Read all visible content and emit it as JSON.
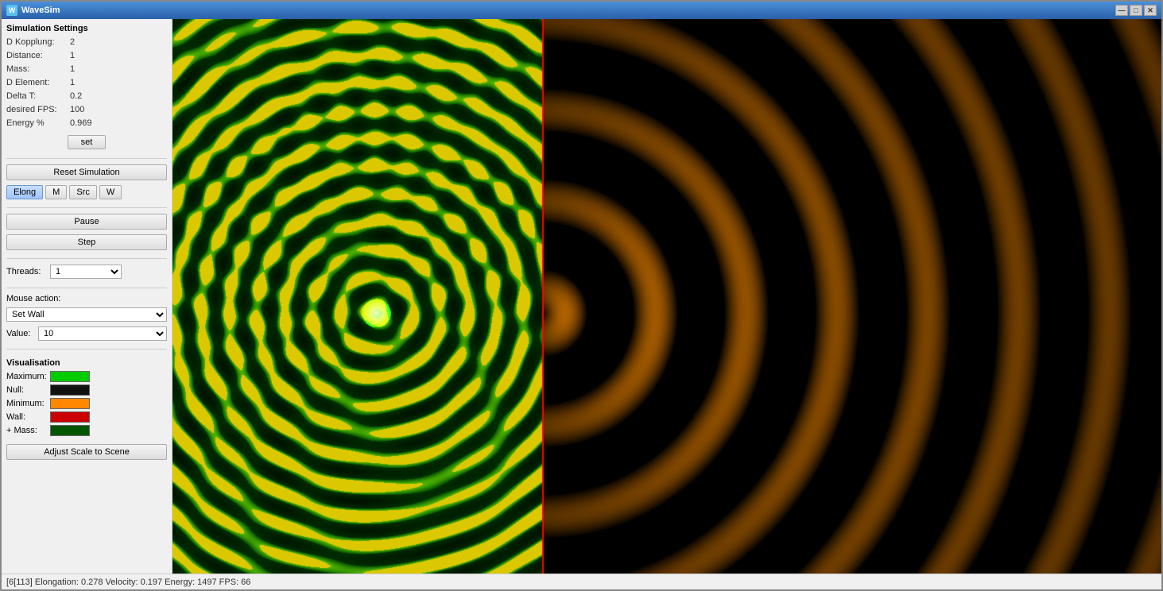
{
  "window": {
    "title": "WaveSim",
    "icon": "W"
  },
  "titlebar": {
    "minimize": "—",
    "maximize": "□",
    "close": "✕"
  },
  "sidebar": {
    "settings_title": "Simulation Settings",
    "fields": [
      {
        "label": "D Kopplung:",
        "value": "2"
      },
      {
        "label": "Distance:",
        "value": "1"
      },
      {
        "label": "Mass:",
        "value": "1"
      },
      {
        "label": "D Element:",
        "value": "1"
      },
      {
        "label": "Delta T:",
        "value": "0.2"
      },
      {
        "label": "desired FPS:",
        "value": "100"
      },
      {
        "label": "Energy %",
        "value": "0.969"
      }
    ],
    "set_button": "set",
    "reset_button": "Reset Simulation",
    "mode_buttons": [
      {
        "label": "Elong",
        "active": true
      },
      {
        "label": "M",
        "active": false
      },
      {
        "label": "Src",
        "active": false
      },
      {
        "label": "W",
        "active": false
      }
    ],
    "pause_button": "Pause",
    "step_button": "Step",
    "threads_label": "Threads:",
    "threads_value": "1",
    "mouse_action_label": "Mouse action:",
    "mouse_action_value": "Set Wall",
    "value_label": "Value:",
    "value_value": "10",
    "visualisation_title": "Visualisation",
    "vis_items": [
      {
        "label": "Maximum:",
        "color": "#00cc00"
      },
      {
        "label": "Null:",
        "color": "#111111"
      },
      {
        "label": "Minimum:",
        "color": "#ff8800"
      },
      {
        "label": "Wall:",
        "color": "#cc0000"
      },
      {
        "label": "+ Mass:",
        "color": "#005500"
      }
    ],
    "adjust_button": "Adjust Scale to Scene"
  },
  "statusbar": {
    "text": "[6[113] Elongation: 0.278  Velocity: 0.197  Energy: 1497  FPS: 66"
  },
  "colors": {
    "accent": "#2a60a9",
    "border": "#888888"
  }
}
